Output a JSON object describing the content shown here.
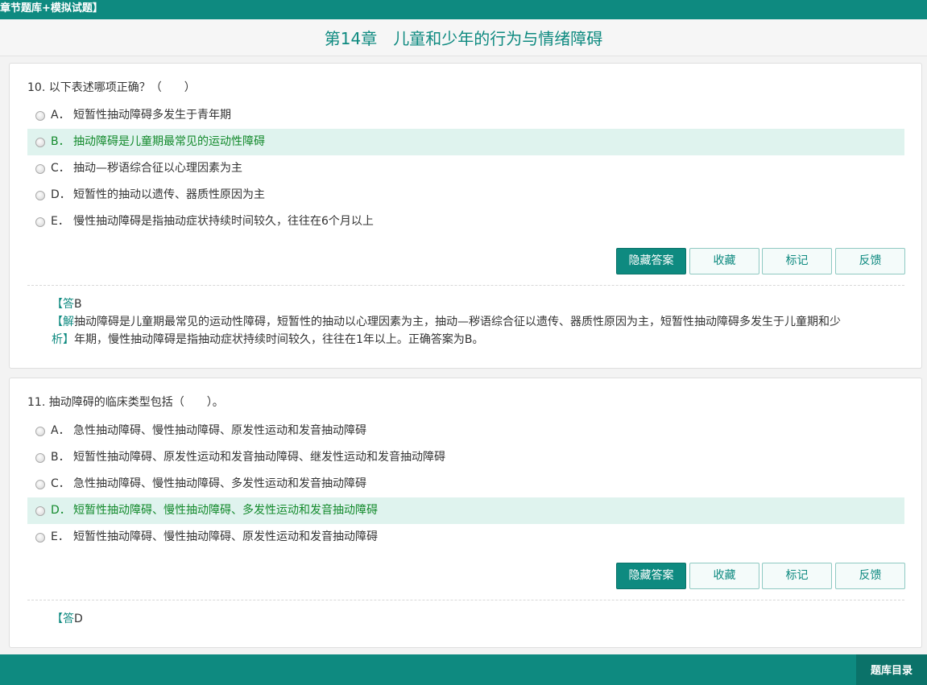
{
  "topbar": {
    "text": "章节题库+模拟试题】"
  },
  "header": {
    "title": "第14章　儿童和少年的行为与情绪障碍"
  },
  "q10": {
    "question": "10. 以下表述哪项正确？（　　）",
    "options": [
      {
        "letter": "A．",
        "text": "短暂性抽动障碍多发生于青年期"
      },
      {
        "letter": "B．",
        "text": "抽动障碍是儿童期最常见的运动性障碍"
      },
      {
        "letter": "C．",
        "text": "抽动—秽语综合征以心理因素为主"
      },
      {
        "letter": "D．",
        "text": "短暂性的抽动以遗传、器质性原因为主"
      },
      {
        "letter": "E．",
        "text": "慢性抽动障碍是指抽动症状持续时间较久，往往在6个月以上"
      }
    ],
    "buttons": {
      "hide": "隐藏答案",
      "favorite": "收藏",
      "mark": "标记",
      "feedback": "反馈"
    },
    "answer_bracket": "【答",
    "answer_value": "B",
    "explanation_bracket_1": "【解",
    "explanation_line_1": "抽动障碍是儿童期最常见的运动性障碍，短暂性的抽动以心理因素为主，抽动—秽语综合征以遗传、器质性原因为主，短暂性抽动障碍多发生于儿童期和少",
    "explanation_bracket_2": "析】",
    "explanation_line_2": "年期，慢性抽动障碍是指抽动症状持续时间较久，往往在1年以上。正确答案为B。"
  },
  "q11": {
    "question": "11. 抽动障碍的临床类型包括（　　）。",
    "options": [
      {
        "letter": "A．",
        "text": "急性抽动障碍、慢性抽动障碍、原发性运动和发音抽动障碍"
      },
      {
        "letter": "B．",
        "text": "短暂性抽动障碍、原发性运动和发音抽动障碍、继发性运动和发音抽动障碍"
      },
      {
        "letter": "C．",
        "text": "急性抽动障碍、慢性抽动障碍、多发性运动和发音抽动障碍"
      },
      {
        "letter": "D．",
        "text": "短暂性抽动障碍、慢性抽动障碍、多发性运动和发音抽动障碍"
      },
      {
        "letter": "E．",
        "text": "短暂性抽动障碍、慢性抽动障碍、原发性运动和发音抽动障碍"
      }
    ],
    "buttons": {
      "hide": "隐藏答案",
      "favorite": "收藏",
      "mark": "标记",
      "feedback": "反馈"
    },
    "answer_bracket": "【答",
    "answer_value": "D"
  },
  "footer": {
    "catalog_button": "题库目录"
  },
  "colors": {
    "brand": "#0e8a80",
    "correct_bg": "#dff3ee",
    "correct_text": "#138a2c"
  }
}
